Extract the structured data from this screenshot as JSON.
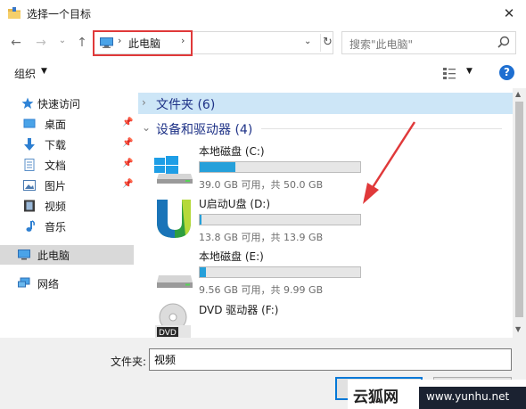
{
  "window": {
    "title": "选择一个目标",
    "close_glyph": "✕"
  },
  "nav": {
    "back_glyph": "←",
    "forward_glyph": "→",
    "recent_glyph": "⌄",
    "up_glyph": "↑",
    "address_sep_glyph": "›",
    "address_location": "此电脑",
    "address_dropdown_glyph": "⌄",
    "refresh_glyph": "↻",
    "search_placeholder": "搜索\"此电脑\""
  },
  "toolbar": {
    "organize_label": "组织",
    "caret_glyph": "▼",
    "help_glyph": "?"
  },
  "sidebar": {
    "items": [
      {
        "label": "快速访问",
        "icon": "star-icon"
      },
      {
        "label": "桌面",
        "icon": "desktop-icon",
        "pinned": true
      },
      {
        "label": "下载",
        "icon": "download-icon",
        "pinned": true
      },
      {
        "label": "文档",
        "icon": "document-icon",
        "pinned": true
      },
      {
        "label": "图片",
        "icon": "picture-icon",
        "pinned": true
      },
      {
        "label": "视频",
        "icon": "video-icon"
      },
      {
        "label": "音乐",
        "icon": "music-icon"
      },
      {
        "label": "此电脑",
        "icon": "computer-icon",
        "selected": true
      },
      {
        "label": "网络",
        "icon": "network-icon"
      }
    ],
    "pin_glyph": "📌"
  },
  "content": {
    "groups": [
      {
        "title": "文件夹 (6)",
        "collapsed": true,
        "chevron_glyph": "›"
      },
      {
        "title": "设备和驱动器 (4)",
        "collapsed": false,
        "chevron_glyph": "⌄"
      }
    ],
    "drives": [
      {
        "name": "本地磁盘 (C:)",
        "size": "39.0 GB 可用，共 50.0 GB",
        "used_fraction": 0.22,
        "icon": "windows-drive-icon"
      },
      {
        "name": "U启动U盘 (D:)",
        "size": "13.8 GB 可用，共 13.9 GB",
        "used_fraction": 0.01,
        "icon": "u-boot-drive-icon"
      },
      {
        "name": "本地磁盘 (E:)",
        "size": "9.56 GB 可用，共 9.99 GB",
        "used_fraction": 0.04,
        "icon": "hard-drive-icon"
      },
      {
        "name": "DVD 驱动器 (F:)",
        "icon": "dvd-drive-icon",
        "dvd_label": "DVD"
      }
    ]
  },
  "scrollbar": {
    "up_glyph": "▲",
    "down_glyph": "▼"
  },
  "bottom": {
    "folder_label": "文件夹:",
    "folder_value": "视频"
  },
  "watermark": {
    "brand": "云狐网",
    "url": "www.yunhu.net"
  },
  "colors": {
    "accent": "#0078d7",
    "highlight_red": "#e0393a",
    "bar_fill": "#26a0da",
    "group_title": "#1e3287"
  }
}
